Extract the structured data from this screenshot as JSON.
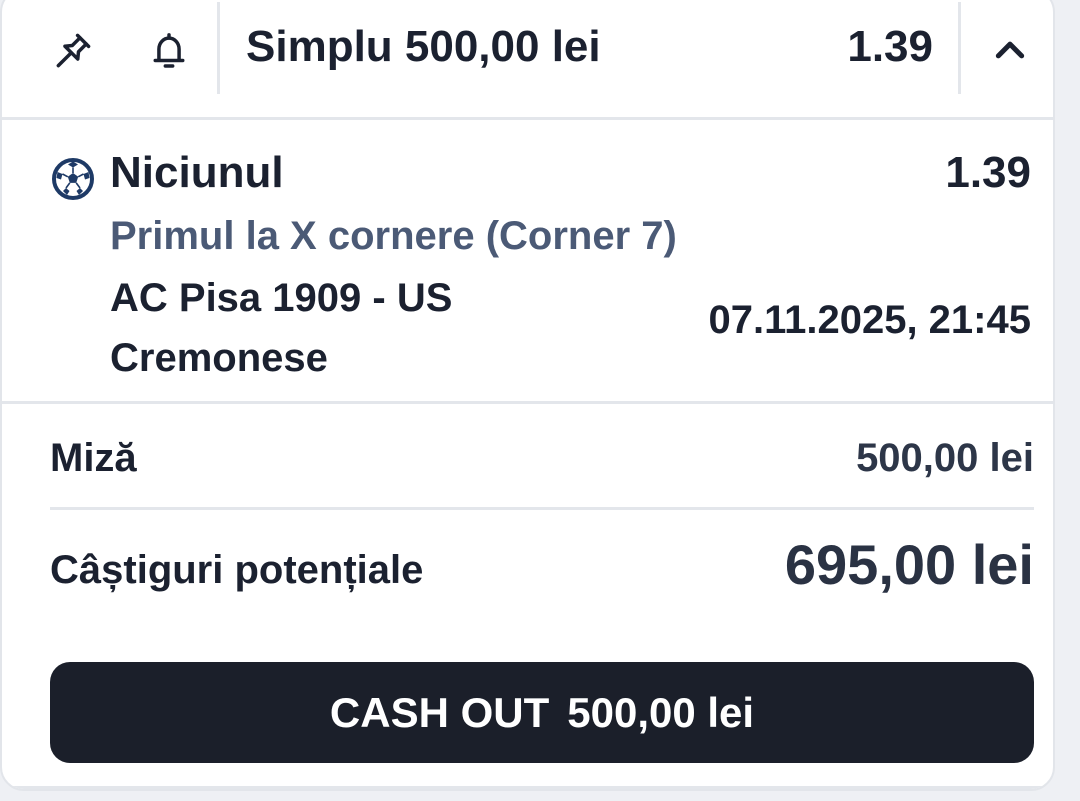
{
  "header": {
    "title": "Simplu 500,00 lei",
    "odds": "1.39",
    "icons": [
      "pin-icon",
      "bell-icon",
      "chevron-up-icon"
    ]
  },
  "selection": {
    "icon": "soccer-ball-icon",
    "name": "Niciunul",
    "odds": "1.39",
    "market": "Primul la X cornere (Corner 7)",
    "event_line1": "AC Pisa 1909 - US",
    "event_line2": "Cremonese",
    "datetime": "07.11.2025, 21:45"
  },
  "stake": {
    "label": "Miză",
    "value": "500,00 lei"
  },
  "winnings": {
    "label": "Câștiguri potențiale",
    "value": "695,00 lei"
  },
  "cashout": {
    "label": "CASH OUT",
    "amount": "500,00 lei"
  },
  "colors": {
    "text": "#1b2130",
    "secondary_text": "#4b5a76",
    "button_bg": "#1b1f2a",
    "divider": "#e3e6eb",
    "ball_icon": "#1e3a66"
  }
}
